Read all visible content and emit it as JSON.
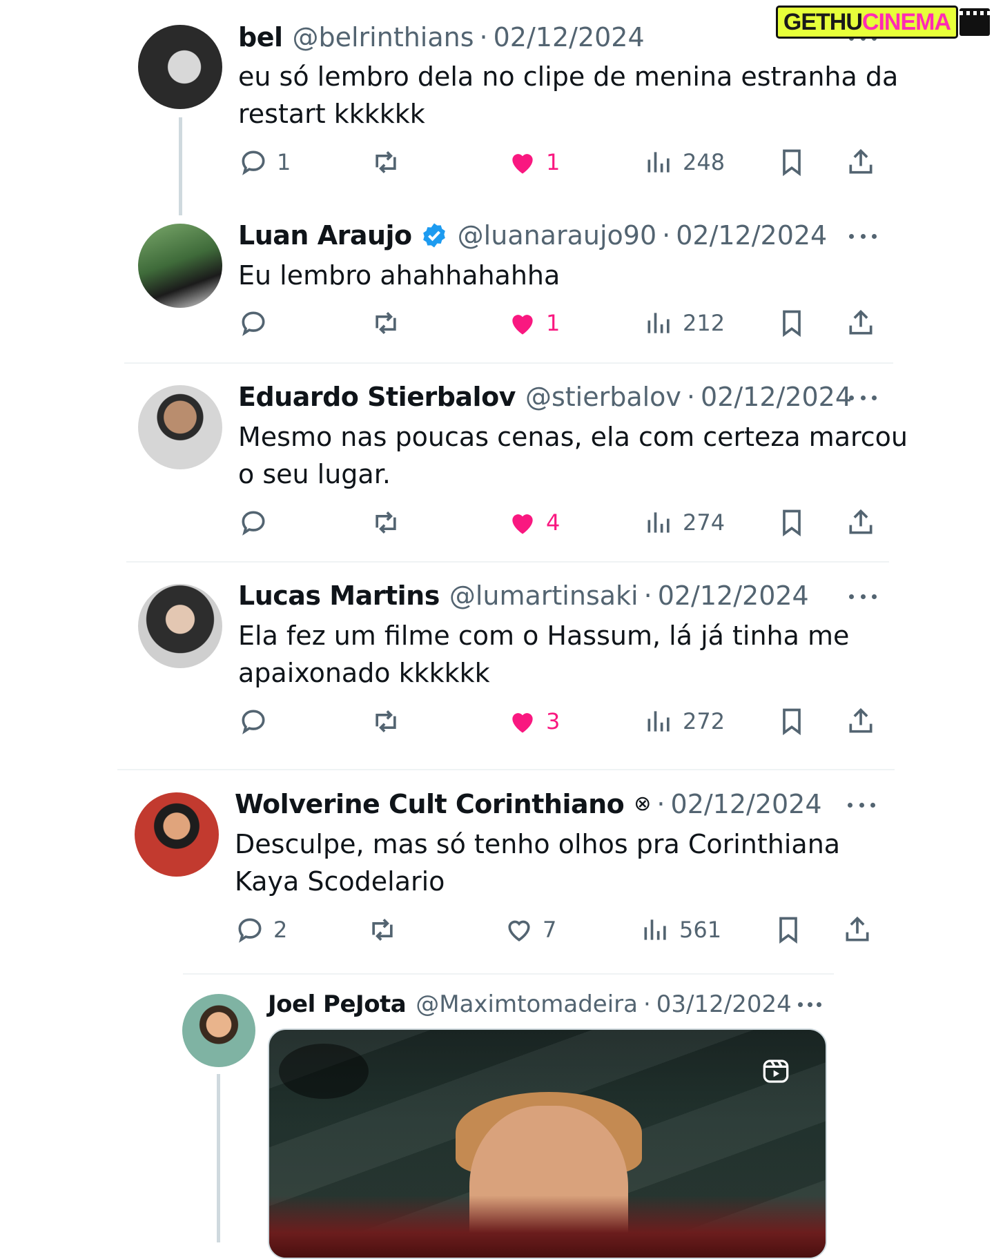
{
  "watermark": {
    "part1": "GETHU",
    "part2": "CINEMA"
  },
  "tweets": [
    {
      "name": "bel",
      "handle": "@belrinthians",
      "date": "02/12/2024",
      "text": "eu só lembro dela no clipe de menina estranha da restart kkkkkk",
      "replies": "1",
      "retweets": "",
      "likes": "1",
      "views": "248",
      "liked": true,
      "verified": false
    },
    {
      "name": "Luan Araujo",
      "handle": "@luanaraujo90",
      "date": "02/12/2024",
      "text": "Eu lembro ahahhahahha",
      "replies": "",
      "retweets": "",
      "likes": "1",
      "views": "212",
      "liked": true,
      "verified": true
    },
    {
      "name": "Eduardo Stierbalov",
      "handle": "@stierbalov",
      "date": "02/12/2024",
      "text": "Mesmo nas poucas cenas,  ela com certeza marcou o seu lugar.",
      "replies": "",
      "retweets": "",
      "likes": "4",
      "views": "274",
      "liked": true,
      "verified": false
    },
    {
      "name": "Lucas Martins",
      "handle": "@lumartinsaki",
      "date": "02/12/2024",
      "text": "Ela fez um filme com o Hassum, lá já tinha me apaixonado kkkkkk",
      "replies": "",
      "retweets": "",
      "likes": "3",
      "views": "272",
      "liked": true,
      "verified": false
    },
    {
      "name": "Wolverine Cult Corinthiano",
      "handle": "",
      "symbol": "⊗",
      "date": "02/12/2024",
      "text": "Desculpe, mas só tenho olhos pra Corinthiana Kaya Scodelario",
      "replies": "2",
      "retweets": "",
      "likes": "7",
      "views": "561",
      "liked": false,
      "verified": false
    },
    {
      "name": "Joel PeJota",
      "handle": "@Maximtomadeira",
      "date": "03/12/2024",
      "text": "",
      "liked": false,
      "verified": false
    }
  ],
  "separator": "·",
  "colors": {
    "like": "#f91880",
    "verified": "#1d9bf0",
    "muted": "#536471",
    "divider": "#eff3f4"
  },
  "icons": [
    "reply-icon",
    "retweet-icon",
    "like-icon",
    "views-icon",
    "bookmark-icon",
    "share-icon",
    "more-icon",
    "verified-icon",
    "reel-icon"
  ]
}
